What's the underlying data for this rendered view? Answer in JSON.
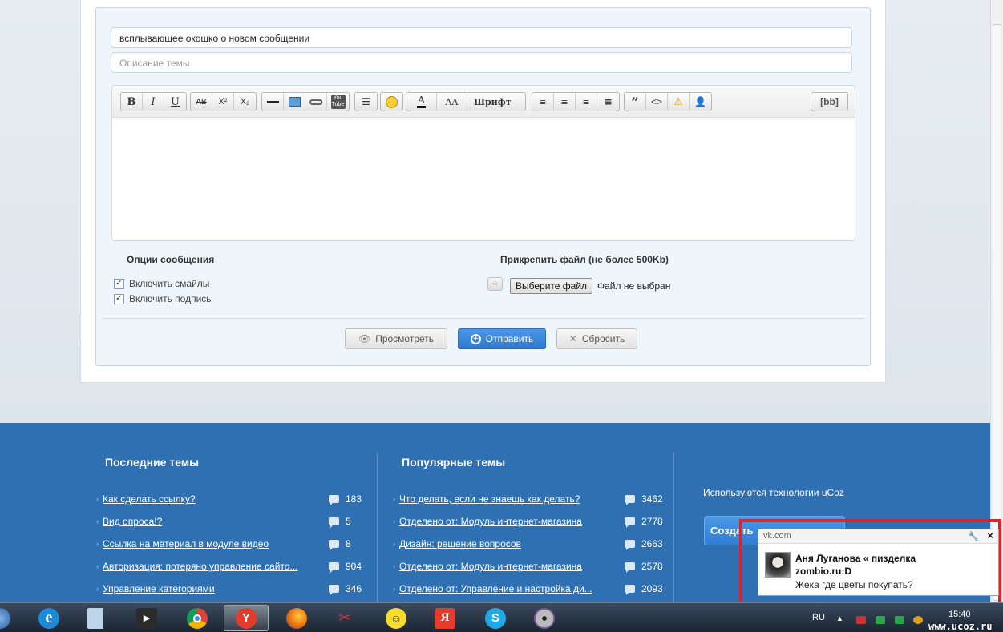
{
  "form": {
    "title_value": "всплывающее окошко о новом сообщении",
    "desc_placeholder": "Описание темы",
    "toolbar": {
      "bold": "B",
      "italic": "I",
      "underline": "U",
      "strike": "AB",
      "sup": "X²",
      "sub": "X₂",
      "youtube": "You Tube",
      "font_size": "AA",
      "font": "Шрифт",
      "quote": "”",
      "code": "<>",
      "bbcode": "[bb]"
    },
    "options_title": "Опции сообщения",
    "opt_smiles": "Включить смайлы",
    "opt_signature": "Включить подпись",
    "attach_title": "Прикрепить файл (не более 500Kb)",
    "attach_plus": "+",
    "file_button": "Выберите файл",
    "file_status": "Файл не выбран",
    "btn_preview": "Просмотреть",
    "btn_send": "Отправить",
    "btn_reset": "Сбросить"
  },
  "footer": {
    "latest_title": "Последние темы",
    "latest": [
      {
        "title": "Как сделать ссылку?",
        "count": "183"
      },
      {
        "title": "Вид опроса!?",
        "count": "5"
      },
      {
        "title": "Ссылка на материал в модуле видео",
        "count": "8"
      },
      {
        "title": "Авторизация: потеряно управление сайто...",
        "count": "904"
      },
      {
        "title": "Управление категориями",
        "count": "346"
      }
    ],
    "popular_title": "Популярные темы",
    "popular": [
      {
        "title": "Что делать, если не знаешь как делать?",
        "count": "3462"
      },
      {
        "title": "Отделено от: Модуль интернет-магазина",
        "count": "2778"
      },
      {
        "title": "Дизайн: решение вопросов",
        "count": "2663"
      },
      {
        "title": "Отделено от: Модуль интернет-магазина",
        "count": "2578"
      },
      {
        "title": "Отделено от: Управление и настройка ди...",
        "count": "2093"
      }
    ],
    "ucoz_text": "Используются технологии uCoz",
    "create_button": "Создать"
  },
  "notification": {
    "source": "vk.com",
    "close": "×",
    "wrench": "🔧",
    "line1": "Аня Луганова « пизделка",
    "line2": "zombio.ru:D",
    "line3": "Жека где цветы покупать?"
  },
  "taskbar": {
    "lang": "RU",
    "tray_arrow": "▲",
    "clock": "15:40",
    "watermark": "www.ucoz.ru",
    "apps": [
      "windows-start",
      "internet-explorer",
      "notepad",
      "media-player",
      "chrome",
      "yandex-browser",
      "firefox",
      "scissors",
      "smiley",
      "yandex",
      "skype",
      "dvd"
    ]
  },
  "colors": {
    "footer_bg": "#2f70b3",
    "send_button": "#2f79d0",
    "notification_frame": "#e02226"
  }
}
